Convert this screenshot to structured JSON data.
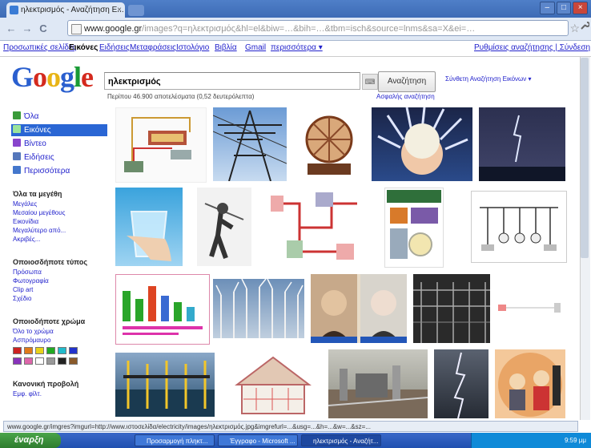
{
  "browser": {
    "tab_title": "ηλεκτρισμός - Αναζήτηση Ε...",
    "tab_close": "×",
    "url_host": "www.google.gr",
    "url_rest": "/images?q=ηλεκτρισμός&hl=el&biw=…&bih=…&tbm=isch&source=lnms&sa=X&ei=…",
    "window_buttons": [
      "–",
      "□",
      "×"
    ],
    "back": "←",
    "forward": "→",
    "reload": "C",
    "star": "☆",
    "wrench": "🔧"
  },
  "gnav": {
    "items": [
      "Προσωπικές σελίδες",
      "Εικόνες",
      "Ειδήσεις",
      "Μεταφράσεις",
      "Ιστολόγιο",
      "Βιβλία",
      "Gmail",
      "περισσότερα ▾"
    ],
    "right": "Ρυθμίσεις αναζήτησης | Σύνδεση"
  },
  "logo": {
    "g1": "G",
    "o1": "o",
    "o2": "o",
    "g2": "g",
    "l": "l",
    "e": "e"
  },
  "search": {
    "query": "ηλεκτρισμός",
    "kbd": "⌨",
    "button": "Αναζήτηση",
    "advanced": "Σύνθετη Αναζήτηση Εικόνων ▾",
    "stats": "Περίπου 46.900 αποτελέσματα (0,52 δευτερόλεπτα)",
    "safesearch": "Ασφαλής αναζήτηση"
  },
  "sidebar": {
    "types": [
      {
        "label": "Όλα",
        "color": "#3a9b3a"
      },
      {
        "label": "Εικόνες",
        "color": "#ffffff"
      },
      {
        "label": "Βίντεο",
        "color": "#8844cc"
      },
      {
        "label": "Ειδήσεις",
        "color": "#5577bb"
      },
      {
        "label": "Περισσότερα",
        "color": "#4477cc"
      }
    ],
    "size_head": "Όλα τα μεγέθη",
    "size_links": [
      "Μεγάλες",
      "Μεσαίου μεγέθους",
      "Εικονίδια",
      "Μεγαλύτερο από...",
      "Ακριβές..."
    ],
    "type_head": "Οποιοσδήποτε τύπος",
    "type_links": [
      "Πρόσωπα",
      "Φωτογραφία",
      "Clip art",
      "Σχέδιο"
    ],
    "color_head": "Οποιοδήποτε χρώμα",
    "color_links": [
      "Όλο το χρώμα",
      "Ασπρόμαυρο"
    ],
    "swatches": [
      "#cc2222",
      "#e07a1a",
      "#e8d21a",
      "#22aa22",
      "#22bbcc",
      "#2233cc",
      "#8833bb",
      "#dd66aa",
      "#ffffff",
      "#999999",
      "#222222",
      "#8a5a2a"
    ],
    "view_head": "Κανονική προβολή",
    "view_link": "Εμφ. φίλτ."
  },
  "status": "www.google.gr/imgres?imgurl=http://www.ιστοσελίδα/electricity/images/ηλεκτρισμός.jpg&imgrefurl=...&usg=...&h=...&w=...&sz=...",
  "taskbar": {
    "start": "έναρξη",
    "tasks": [
      "Προσαρμογή πληκτ...",
      "Έγγραφο - Microsoft ...",
      "ηλεκτρισμός - Αναζήτ..."
    ],
    "clock": "9:59 μμ"
  }
}
